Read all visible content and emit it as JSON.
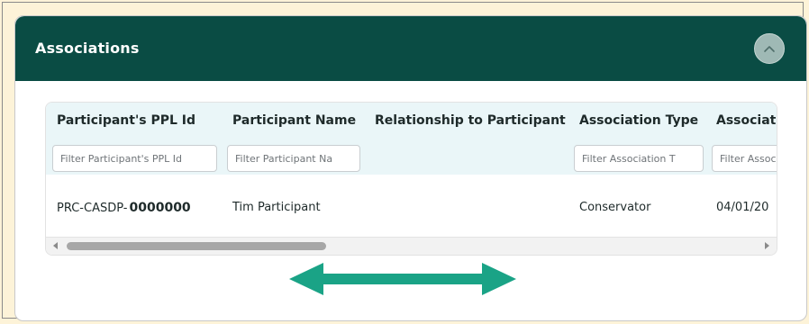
{
  "panel": {
    "title": "Associations",
    "collapse_icon": "chevron-up-icon"
  },
  "grid": {
    "columns": [
      {
        "title": "Participant's PPL Id",
        "filter_placeholder": "Filter Participant's PPL Id"
      },
      {
        "title": "Participant Name",
        "filter_placeholder": "Filter Participant Na"
      },
      {
        "title": "Relationship to Participant",
        "filter_placeholder": ""
      },
      {
        "title": "Association Type",
        "filter_placeholder": "Filter Association T"
      },
      {
        "title": "Associati",
        "filter_placeholder": "Filter Assoc"
      }
    ],
    "rows": [
      {
        "ppl_id_prefix": "PRC-CASDP-",
        "ppl_id_number": "0000000",
        "participant_name": "Tim Participant",
        "relationship": "",
        "association_type": "Conservator",
        "association_date": "04/01/20"
      }
    ],
    "scroll_fraction": 0.36
  },
  "annotation": {
    "icon": "double-arrow-horizontal-icon",
    "color": "#1aa386"
  },
  "colors": {
    "header_bg": "#0a4c44",
    "page_bg": "#fdf3d8",
    "table_header_bg": "#eaf6f8"
  }
}
